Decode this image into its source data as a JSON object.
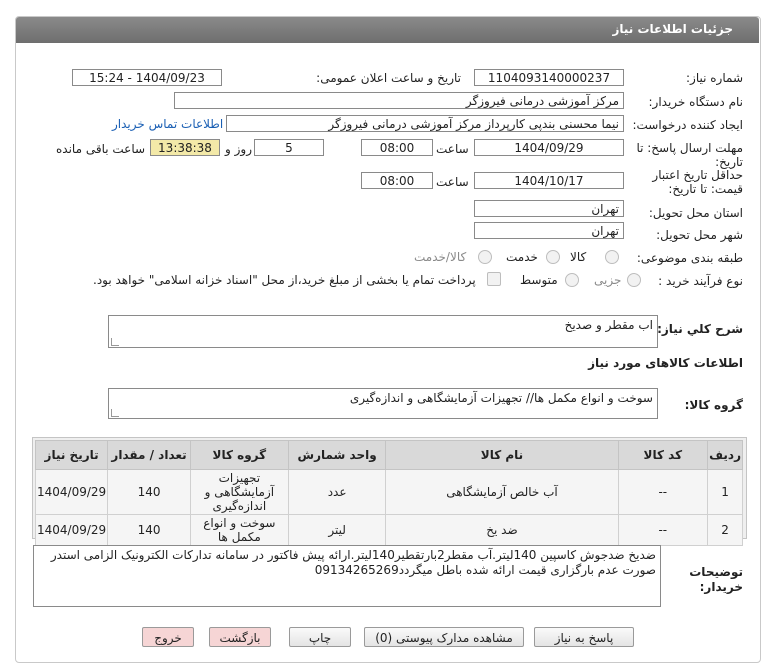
{
  "header": {
    "title": "جزئیات اطلاعات نیاز"
  },
  "fields": {
    "need_number_label": "شماره نیاز:",
    "need_number": "1104093140000237",
    "announce_label": "تاریخ و ساعت اعلان عمومی:",
    "announce_value": "1404/09/23 - 15:24",
    "buyer_org_label": "نام دستگاه خریدار:",
    "buyer_org": "مرکز آموزشی درمانی فیروزگر",
    "creator_label": "ایجاد کننده درخواست:",
    "creator": "نیما محسنی بندپی کارپرداز مرکز آموزشی درمانی فیروزگر",
    "contact_link": "اطلاعات تماس خریدار",
    "deadline_label_1": "مهلت ارسال پاسخ: تا",
    "deadline_label_2": "تاریخ:",
    "deadline_date": "1404/09/29",
    "time_label": "ساعت",
    "deadline_time": "08:00",
    "days_value": "5",
    "days_label": "روز و",
    "remaining_time": "13:38:38",
    "remaining_label": "ساعت باقی مانده",
    "validity_label_1": "حداقل تاریخ اعتبار",
    "validity_label_2": "قیمت: تا تاریخ:",
    "validity_date": "1404/10/17",
    "validity_time": "08:00",
    "province_label": "استان محل تحویل:",
    "province": "تهران",
    "city_label": "شهر محل تحویل:",
    "city": "تهران",
    "category_label": "طبقه بندی موضوعی:",
    "category_options": [
      "کالا",
      "خدمت",
      "کالا/خدمت"
    ],
    "process_label": "نوع فرآیند خرید :",
    "process_options": [
      "جزیی",
      "متوسط"
    ],
    "payment_note": "پرداخت تمام یا بخشی از مبلغ خرید،از محل \"اسناد خزانه اسلامی\" خواهد بود."
  },
  "summary": {
    "label": "شرح کلي نياز:",
    "value": "اب مقطر و صدیخ"
  },
  "goods": {
    "section_title": "اطلاعات کالاهای مورد نیاز",
    "group_label": "گروه کالا:",
    "group_value": "سوخت و انواع مکمل ها// تجهیزات آزمایشگاهی و اندازه‌گیری"
  },
  "table": {
    "headers": [
      "ردیف",
      "کد کالا",
      "نام کالا",
      "واحد شمارش",
      "گروه کالا",
      "تعداد / مقدار",
      "تاریخ نیاز"
    ],
    "rows": [
      [
        "1",
        "--",
        "آب خالص آزمایشگاهی",
        "عدد",
        "تجهیزات آزمایشگاهی و اندازه‌گیری",
        "140",
        "1404/09/29"
      ],
      [
        "2",
        "--",
        "ضد یخ",
        "لیتر",
        "سوخت و انواع مکمل ها",
        "140",
        "1404/09/29"
      ]
    ]
  },
  "notes": {
    "label_1": "توضیحات",
    "label_2": "خریدار:",
    "value": "ضدیخ ضدجوش کاسپین 140لیتر.آب مقطر2بارتقطیر140لیتر.ارائه پیش فاکتور در سامانه تدارکات الکترونیک الزامی استدر صورت عدم بارگزاری قیمت ارائه شده باطل میگردد09134265269"
  },
  "buttons": {
    "respond": "پاسخ به نیاز",
    "attachments": "مشاهده مدارک پیوستی (0)",
    "print": "چاپ",
    "back": "بازگشت",
    "exit": "خروج"
  },
  "colors": {
    "header": "#7a7a7a",
    "remaining_bg": "#f3e9a8",
    "link": "#1a5fb4",
    "pink_button": "#f6d5d5"
  }
}
